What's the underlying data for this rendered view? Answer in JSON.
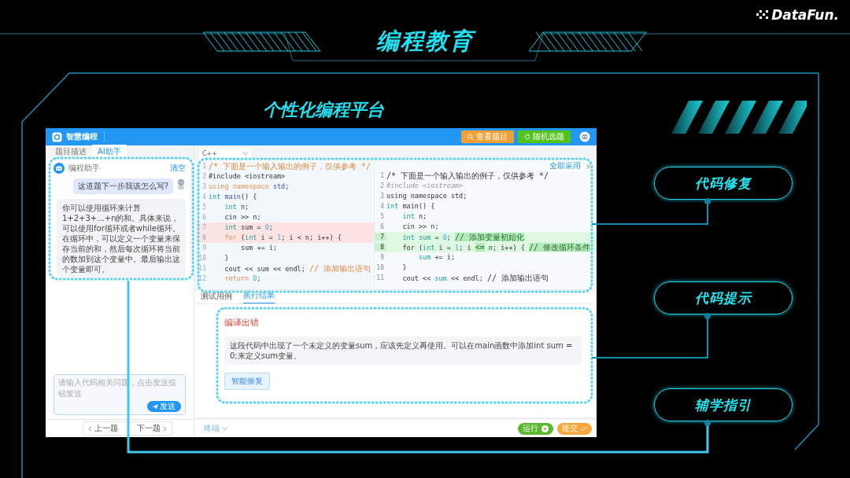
{
  "slide": {
    "title": "编程教育",
    "subtitle": "个性化编程平台",
    "logo": "DataFun."
  },
  "app": {
    "brand": "智慧编程",
    "buttons": [
      {
        "label": "查看题目",
        "kind": "view"
      },
      {
        "label": "随机选题",
        "kind": "random"
      }
    ]
  },
  "left_panel": {
    "tabs": [
      {
        "label": "题目描述",
        "selected": false
      },
      {
        "label": "AI助手",
        "selected": true
      }
    ],
    "assistant": {
      "name": "编程助手",
      "clear": "清空"
    },
    "messages": [
      {
        "kind": "user",
        "text": "这道题下一步我该怎么写?"
      },
      {
        "kind": "assistant",
        "text": "你可以使用循环来计算1+2+3+...+n的和。具体来说，可以使用for循环或者while循环。在循环中，可以定义一个变量来保存当前的和，然后每次循环将当前的数加到这个变量中。最后输出这个变量即可。"
      }
    ],
    "input": {
      "placeholder": "请输入代码相关问题，点击发送按钮发送",
      "send": "发送"
    },
    "pager": {
      "prev": "上一题",
      "next": "下一题"
    }
  },
  "editor": {
    "language": "C++",
    "accept_all": "全部采用",
    "close": "×",
    "original": [
      {
        "number": "1",
        "kind": "normal",
        "segments": [
          {
            "text": "/* 下面是一个输入输出的例子，仅供参考 */",
            "kind": "comment"
          }
        ]
      },
      {
        "number": "2",
        "kind": "normal",
        "segments": [
          {
            "text": "#include <iostream>",
            "kind": "plain"
          }
        ]
      },
      {
        "number": "3",
        "kind": "normal",
        "segments": [
          {
            "text": "using namespace",
            "kind": "keyword"
          },
          {
            "text": " std",
            "kind": "name"
          },
          {
            "text": ";",
            "kind": "plain"
          }
        ]
      },
      {
        "number": "4",
        "kind": "normal",
        "segments": [
          {
            "text": "int",
            "kind": "type"
          },
          {
            "text": " main",
            "kind": "name"
          },
          {
            "text": "() {",
            "kind": "plain"
          }
        ]
      },
      {
        "number": "5",
        "kind": "normal",
        "segments": [
          {
            "text": "    int",
            "kind": "type"
          },
          {
            "text": " n;",
            "kind": "plain"
          }
        ]
      },
      {
        "number": "6",
        "kind": "normal",
        "segments": [
          {
            "text": "    cin >> n;",
            "kind": "plain"
          }
        ]
      },
      {
        "number": "7",
        "kind": "removed",
        "segments": [
          {
            "text": "    int",
            "kind": "type"
          },
          {
            "text": " sum = ",
            "kind": "plain"
          },
          {
            "text": "0",
            "kind": "number"
          },
          {
            "text": ";",
            "kind": "plain"
          }
        ]
      },
      {
        "number": "8",
        "kind": "removed",
        "segments": [
          {
            "text": "    for",
            "kind": "keyword"
          },
          {
            "text": " (",
            "kind": "plain"
          },
          {
            "text": "int",
            "kind": "type"
          },
          {
            "text": " i = ",
            "kind": "plain"
          },
          {
            "text": "1",
            "kind": "number"
          },
          {
            "text": "; i < n; i++) {",
            "kind": "plain"
          }
        ]
      },
      {
        "number": "9",
        "kind": "normal",
        "segments": [
          {
            "text": "        sum += i;",
            "kind": "plain"
          }
        ]
      },
      {
        "number": "10",
        "kind": "normal",
        "segments": [
          {
            "text": "    }",
            "kind": "plain"
          }
        ]
      },
      {
        "number": "11",
        "kind": "normal",
        "segments": [
          {
            "text": "    cout << sum << endl; ",
            "kind": "plain"
          },
          {
            "text": "// 添加输出语句",
            "kind": "comment"
          }
        ]
      },
      {
        "number": "12",
        "kind": "normal",
        "segments": [
          {
            "text": "    return",
            "kind": "keyword"
          },
          {
            "text": " 0",
            "kind": "number"
          },
          {
            "text": ";",
            "kind": "plain"
          }
        ]
      }
    ],
    "suggested": [
      {
        "number": "1",
        "kind": "normal",
        "segments": [
          {
            "text": "/* 下面是一个输入输出的例子，仅供参考 */",
            "kind": "text"
          }
        ]
      },
      {
        "number": "2",
        "kind": "normal",
        "segments": [
          {
            "text": "#include <iostream>",
            "kind": "preproc"
          }
        ]
      },
      {
        "number": "3",
        "kind": "normal",
        "segments": [
          {
            "text": "using namespace std;",
            "kind": "plain"
          }
        ]
      },
      {
        "number": "4",
        "kind": "normal",
        "segments": [
          {
            "text": "int",
            "kind": "type"
          },
          {
            "text": " main() {",
            "kind": "plain"
          }
        ]
      },
      {
        "number": "5",
        "kind": "normal",
        "segments": [
          {
            "text": "    int",
            "kind": "type"
          },
          {
            "text": " n;",
            "kind": "plain"
          }
        ]
      },
      {
        "number": "6",
        "kind": "normal",
        "segments": [
          {
            "text": "    cin >> n;",
            "kind": "plain"
          }
        ]
      },
      {
        "number": "7",
        "kind": "added",
        "segments": [
          {
            "text": "    int sum",
            "kind": "type"
          },
          {
            "text": " = ",
            "kind": "plain"
          },
          {
            "text": "0",
            "kind": "number"
          },
          {
            "text": "; ",
            "kind": "plain"
          },
          {
            "text": "// 添加变量初始化",
            "kind": "insert"
          }
        ]
      },
      {
        "number": "8",
        "kind": "added",
        "segments": [
          {
            "text": "    for (",
            "kind": "plain"
          },
          {
            "text": "int",
            "kind": "type"
          },
          {
            "text": " i = ",
            "kind": "plain"
          },
          {
            "text": "1",
            "kind": "number"
          },
          {
            "text": "; i ",
            "kind": "plain"
          },
          {
            "text": "<=",
            "kind": "insert"
          },
          {
            "text": " n; i++) { ",
            "kind": "plain"
          },
          {
            "text": "// 修改循环条件",
            "kind": "insert"
          }
        ]
      },
      {
        "number": "9",
        "kind": "normal",
        "segments": [
          {
            "text": "        sum",
            "kind": "type"
          },
          {
            "text": " += i;",
            "kind": "plain"
          }
        ]
      },
      {
        "number": "10",
        "kind": "normal",
        "segments": [
          {
            "text": "    }",
            "kind": "plain"
          }
        ]
      },
      {
        "number": "11",
        "kind": "normal",
        "segments": [
          {
            "text": "    cout << ",
            "kind": "plain"
          },
          {
            "text": "sum",
            "kind": "type"
          },
          {
            "text": " << endl; ",
            "kind": "plain"
          },
          {
            "text": "// 添加输出语句",
            "kind": "text"
          }
        ]
      }
    ]
  },
  "bottom_tabs": [
    {
      "label": "测试用例",
      "selected": false
    },
    {
      "label": "执行结果",
      "selected": true
    }
  ],
  "result": {
    "status": "编译出错",
    "message": "这段代码中出现了一个未定义的变量sum，应该先定义再使用。可以在main函数中添加int sum = 0;来定义sum变量。",
    "fix_button": "智能修复"
  },
  "footer": {
    "terminal": "终端",
    "run": "运行",
    "submit": "提交"
  },
  "features": [
    {
      "label": "代码修复"
    },
    {
      "label": "代码提示"
    },
    {
      "label": "辅学指引"
    }
  ]
}
